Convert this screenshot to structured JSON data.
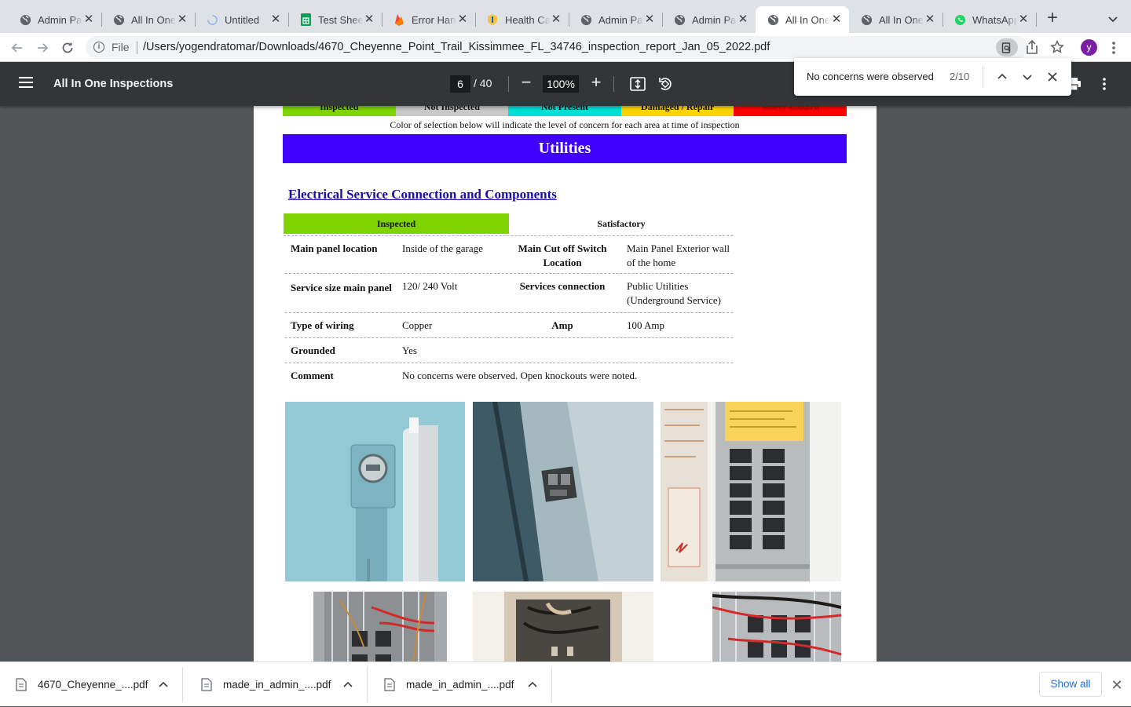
{
  "browser": {
    "tabs": [
      {
        "title": "Admin Panel",
        "icon": "globe-icon"
      },
      {
        "title": "All In One",
        "icon": "globe-icon"
      },
      {
        "title": "Untitled",
        "icon": "loading-icon"
      },
      {
        "title": "Test Sheet",
        "icon": "sheets-icon"
      },
      {
        "title": "Error Handling",
        "icon": "firebase-icon"
      },
      {
        "title": "Health Care",
        "icon": "health-icon"
      },
      {
        "title": "Admin Panel",
        "icon": "globe-icon"
      },
      {
        "title": "Admin Panel",
        "icon": "globe-icon"
      },
      {
        "title": "All In One",
        "icon": "globe-icon",
        "active": true
      },
      {
        "title": "All In One",
        "icon": "globe-icon"
      },
      {
        "title": "WhatsApp",
        "icon": "whatsapp-icon"
      }
    ],
    "omnibox": {
      "scheme": "File",
      "url": "/Users/yogendratomar/Downloads/4670_Cheyenne_Point_Trail_Kissimmee_FL_34746_inspection_report_Jan_05_2022.pdf"
    },
    "profile_initial": "y"
  },
  "pdf_toolbar": {
    "title": "All In One Inspections",
    "page_current": "6",
    "page_total": "/ 40",
    "zoom": "100%"
  },
  "find_bar": {
    "query": "No concerns were observed",
    "count": "2/10"
  },
  "report": {
    "legend": [
      {
        "label": "Inspected",
        "bg": "#7fd300",
        "fg": "#111111"
      },
      {
        "label": "Not Inspected",
        "bg": "#c8c8c8",
        "fg": "#111111"
      },
      {
        "label": "Not Present",
        "bg": "#00e0d6",
        "fg": "#111111"
      },
      {
        "label": "Damaged / Repair",
        "bg": "#ffd400",
        "fg": "#111111"
      },
      {
        "label": "Safety Hazard",
        "bg": "#ff0000",
        "fg": "#b30000"
      }
    ],
    "legend_note": "Color of selection below will indicate the level of concern for each area at time of inspection",
    "section_title": "Utilities",
    "subsection_title": "Electrical Service Connection and Components ",
    "status": "Inspected",
    "condition": "Satisfactory",
    "specs": [
      {
        "k": "Main panel location",
        "v": "Inside of the garage",
        "k2": "Main Cut off Switch Location",
        "v2": "Main Panel Exterior wall of the home"
      },
      {
        "k": "Service size main panel",
        "v": "120/ 240 Volt",
        "k2": "Services connection",
        "v2": "Public Utilities (Underground Service)"
      },
      {
        "k": "Type of wiring",
        "v": "Copper",
        "k2": "Amp",
        "v2": "100 Amp"
      },
      {
        "k": "Grounded",
        "v": "Yes",
        "k2": "",
        "v2": ""
      },
      {
        "k": "Comment",
        "v": "No concerns were observed. Open knockouts were noted.",
        "k2": "",
        "v2": ""
      }
    ]
  },
  "downloads": [
    {
      "name": "4670_Cheyenne_....pdf"
    },
    {
      "name": "made_in_admin_....pdf"
    },
    {
      "name": "made_in_admin_....pdf"
    }
  ],
  "shelf": {
    "show_all": "Show all"
  },
  "colors": {
    "section_blue": "#4000ff",
    "link_blue": "#1a0dab",
    "inspected_green": "#7fd300",
    "pdf_toolbar": "#323639",
    "viewer_bg": "#525659"
  }
}
